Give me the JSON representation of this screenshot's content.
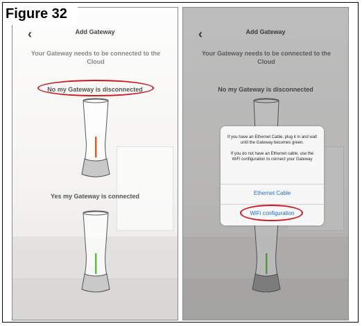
{
  "figure_label": "Figure 32",
  "left": {
    "back_icon": "chevron-left-icon",
    "title": "Add Gateway",
    "subtitle": "Your Gateway needs to be connected to the Cloud",
    "option_disconnected": "No my Gateway is disconnected",
    "option_connected": "Yes my Gateway is connected",
    "led_top_color": "#e05a1e",
    "led_bottom_color": "#5cc23a"
  },
  "right": {
    "back_icon": "chevron-left-icon",
    "title": "Add Gateway",
    "subtitle": "Your Gateway needs to be connected to the Cloud",
    "option_disconnected": "No my Gateway is disconnected",
    "dialog": {
      "message_1": "If you have an Ethernet Cable, plug it in and wait until the Gateway becomes green.",
      "message_2": "If you do not have an Ethernet cable, use the WiFi configuration to connect your Gateway",
      "button_ethernet": "Ethernet Cable",
      "button_wifi": "WiFi configuration"
    },
    "led_bottom_color": "#5cc23a"
  },
  "colors": {
    "highlight": "#d0161e",
    "link": "#1f6fd1"
  }
}
